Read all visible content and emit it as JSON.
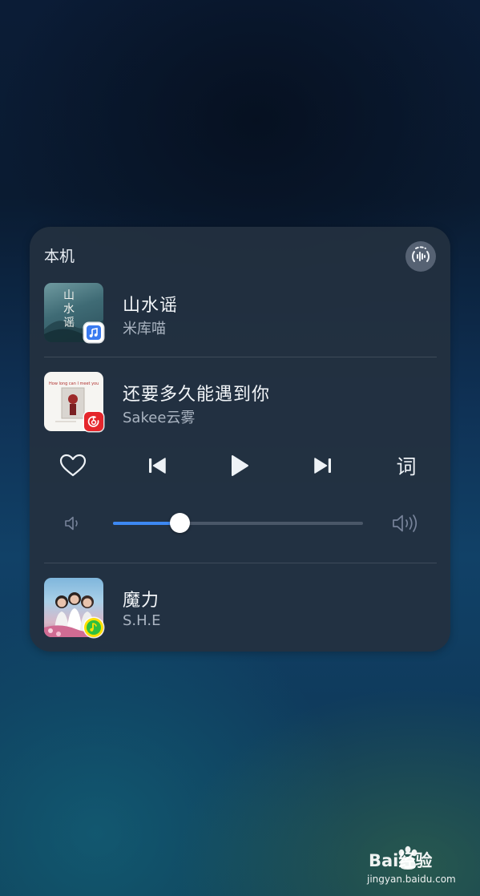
{
  "panel": {
    "title": "本机",
    "audio_output_icon": "waveform-cast-icon"
  },
  "tracks": [
    {
      "title": "山水谣",
      "artist": "米库喵",
      "cover_text": "山水谣",
      "app_badge_icon": "music-note-app-icon",
      "app_badge_color": "#3a7bf0"
    },
    {
      "title": "还要多久能遇到你",
      "artist": "Sakee云雾",
      "cover_text": "How long can I meet you",
      "app_badge_icon": "netease-cloud-music-icon",
      "app_badge_color": "#e5262c"
    },
    {
      "title": "魔力",
      "artist": "S.H.E",
      "app_badge_icon": "qq-music-icon",
      "app_badge_color": "#2fbf3f"
    }
  ],
  "controls": {
    "like_icon": "heart-icon",
    "previous_icon": "previous-track-icon",
    "play_icon": "play-icon",
    "next_icon": "next-track-icon",
    "lyrics_label": "词"
  },
  "volume": {
    "level": 0.265,
    "low_icon": "volume-low-icon",
    "high_icon": "volume-high-icon",
    "accent_color": "#3d88f2"
  },
  "watermark": {
    "logo_text": "Bai经验",
    "url": "jingyan.baidu.com"
  }
}
